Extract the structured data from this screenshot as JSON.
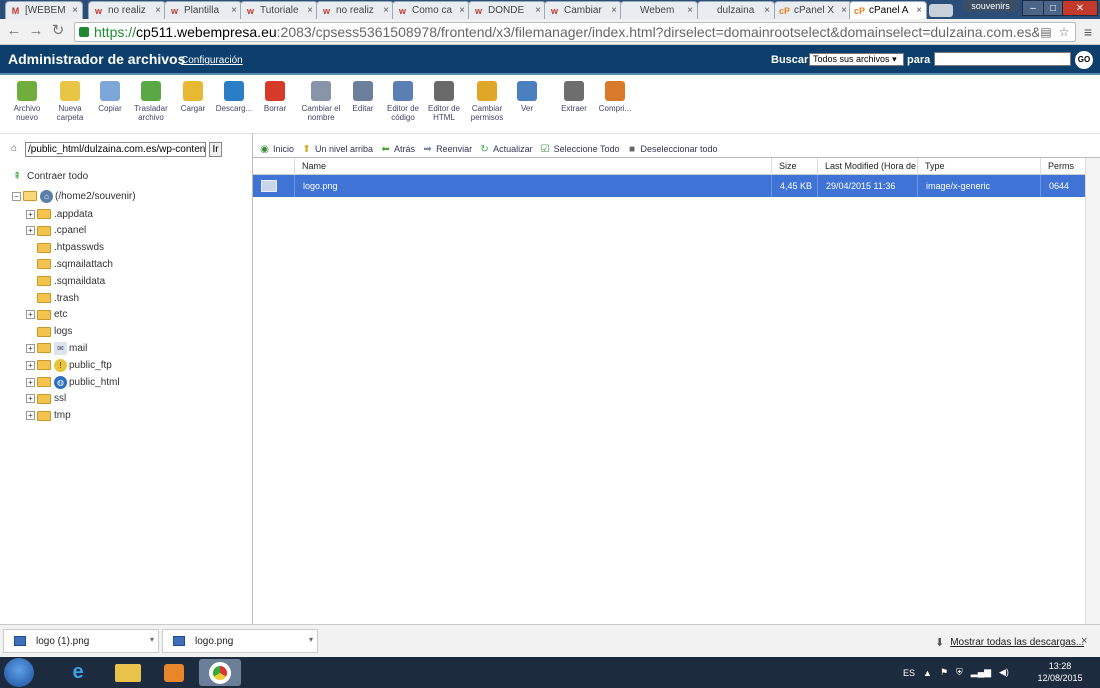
{
  "browser": {
    "tabs": [
      {
        "label": "[WEBEM",
        "favicon": "M",
        "color": "#c0392b"
      },
      {
        "label": "no realiz",
        "favicon": "w",
        "color": "#c0392b"
      },
      {
        "label": "Plantilla",
        "favicon": "w",
        "color": "#c0392b"
      },
      {
        "label": "Tutoriale",
        "favicon": "w",
        "color": "#c0392b"
      },
      {
        "label": "no realiz",
        "favicon": "w",
        "color": "#c0392b"
      },
      {
        "label": "Como ca",
        "favicon": "w",
        "color": "#c0392b"
      },
      {
        "label": "DONDE",
        "favicon": "w",
        "color": "#c0392b"
      },
      {
        "label": "Cambiar",
        "favicon": "w",
        "color": "#c0392b"
      },
      {
        "label": "Webem",
        "favicon": "",
        "color": "#777"
      },
      {
        "label": "dulzaina",
        "favicon": "",
        "color": "#777"
      },
      {
        "label": "cPanel X",
        "favicon": "cP",
        "color": "#e67e22"
      },
      {
        "label": "cPanel A",
        "favicon": "cP",
        "color": "#e67e22"
      }
    ],
    "tab_close": "×",
    "user_badge": "souvenirs",
    "url_https": "https://",
    "url_host": "cp511.webempresa.eu",
    "url_rest": ":2083/cpsess5361508978/frontend/x3/filemanager/index.html?dirselect=domainrootselect&domainselect=dulzaina.com.es&dir=%2Fhome2%2Fso"
  },
  "header": {
    "title": "Administrador de archivos",
    "config_link": "Configuración",
    "search_label": "Buscar",
    "search_scope": "Todos sus archivos",
    "para_label": "para",
    "go_label": "GO"
  },
  "toolbar": [
    {
      "label": "Archivo nuevo",
      "icon": "new-file-icon",
      "color": "#6fae3c"
    },
    {
      "label": "Nueva carpeta",
      "icon": "new-folder-icon",
      "color": "#e8c545"
    },
    {
      "label": "Copiar",
      "icon": "copy-icon",
      "color": "#7da7d9"
    },
    {
      "label": "Trasladar archivo",
      "icon": "move-file-icon",
      "color": "#5aa845"
    },
    {
      "label": "Cargar",
      "icon": "upload-icon",
      "color": "#e8b835"
    },
    {
      "label": "Descarg...",
      "icon": "download-icon",
      "color": "#2a7ec7"
    },
    {
      "label": "Borrar",
      "icon": "delete-icon",
      "color": "#d63a2a"
    },
    {
      "label": "Cambiar el nombre",
      "icon": "rename-icon",
      "color": "#8894a8"
    },
    {
      "label": "Editar",
      "icon": "edit-icon",
      "color": "#6d7f9c"
    },
    {
      "label": "Editor de código",
      "icon": "code-editor-icon",
      "color": "#5b7fb5"
    },
    {
      "label": "Editor de HTML",
      "icon": "html-editor-icon",
      "color": "#6a6a6a"
    },
    {
      "label": "Cambiar permisos",
      "icon": "permissions-icon",
      "color": "#e0a628"
    },
    {
      "label": "Ver",
      "icon": "view-icon",
      "color": "#4a7fc0"
    },
    {
      "label": "Extraer",
      "icon": "extract-icon",
      "color": "#6e6e6e"
    },
    {
      "label": "Compri...",
      "icon": "compress-icon",
      "color": "#d97a2a"
    }
  ],
  "sidebar": {
    "path": "/public_html/dulzaina.com.es/wp-content",
    "go": "Ir",
    "collapse_all": "Contraer todo",
    "root": "(/home2/souvenir)",
    "folders": [
      {
        "name": ".appdata",
        "expandable": true
      },
      {
        "name": ".cpanel",
        "expandable": true
      },
      {
        "name": ".htpasswds",
        "expandable": false
      },
      {
        "name": ".sqmailattach",
        "expandable": false
      },
      {
        "name": ".sqmaildata",
        "expandable": false
      },
      {
        "name": ".trash",
        "expandable": false
      },
      {
        "name": "etc",
        "expandable": true
      },
      {
        "name": "logs",
        "expandable": false
      },
      {
        "name": "mail",
        "expandable": true,
        "extra": "mail-icon"
      },
      {
        "name": "public_ftp",
        "expandable": true,
        "extra": "ftp-icon"
      },
      {
        "name": "public_html",
        "expandable": true,
        "extra": "globe-icon"
      },
      {
        "name": "ssl",
        "expandable": true
      },
      {
        "name": "tmp",
        "expandable": true
      }
    ]
  },
  "navbar": [
    {
      "label": "Inicio",
      "icon": "home-icon",
      "color": "#3a8a3a"
    },
    {
      "label": "Un nivel arriba",
      "icon": "up-level-icon",
      "color": "#d8a62a"
    },
    {
      "label": "Atrás",
      "icon": "back-icon",
      "color": "#4aa83a"
    },
    {
      "label": "Reenviar",
      "icon": "forward-icon",
      "color": "#7a8aa0"
    },
    {
      "label": "Actualizar",
      "icon": "refresh-icon",
      "color": "#3aa84a"
    },
    {
      "label": "Seleccione Todo",
      "icon": "select-all-icon",
      "color": "#3a8a3a"
    },
    {
      "label": "Deseleccionar todo",
      "icon": "deselect-all-icon",
      "color": "#666"
    }
  ],
  "table": {
    "columns": [
      "Name",
      "Size",
      "Last Modified (Hora de v",
      "Type",
      "Perms"
    ],
    "rows": [
      {
        "name": "logo.png",
        "size": "4,45 KB",
        "modified": "29/04/2015 11:36",
        "type": "image/x-generic",
        "perms": "0644"
      }
    ]
  },
  "downloads": {
    "items": [
      "logo (1).png",
      "logo.png"
    ],
    "show_all": "Mostrar todas las descargas...",
    "close": "×"
  },
  "taskbar": {
    "lang": "ES",
    "time": "13:28",
    "date": "12/08/2015"
  }
}
